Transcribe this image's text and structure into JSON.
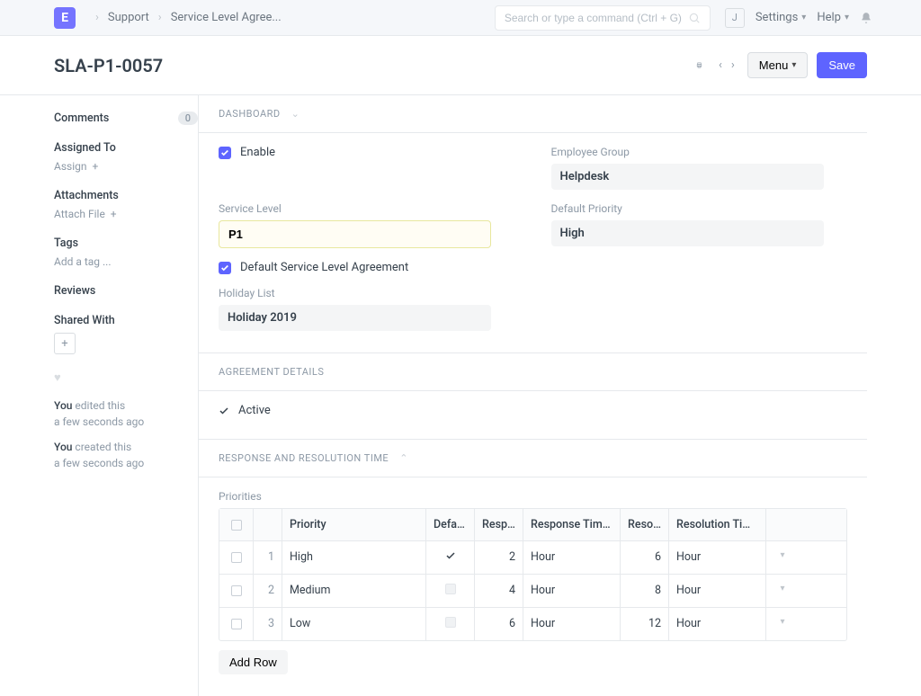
{
  "topbar": {
    "logo_letter": "E",
    "breadcrumb": [
      "Support",
      "Service Level Agree..."
    ],
    "search_placeholder": "Search or type a command (Ctrl + G)",
    "avatar_initial": "J",
    "settings_label": "Settings",
    "help_label": "Help"
  },
  "header": {
    "title": "SLA-P1-0057",
    "menu_label": "Menu",
    "save_label": "Save"
  },
  "sidebar": {
    "comments_label": "Comments",
    "comments_count": "0",
    "assigned_to_label": "Assigned To",
    "assign_action": "Assign",
    "attachments_label": "Attachments",
    "attach_action": "Attach File",
    "tags_label": "Tags",
    "add_tag_action": "Add a tag ...",
    "reviews_label": "Reviews",
    "shared_with_label": "Shared With",
    "activity": [
      {
        "who": "You",
        "what": "edited this",
        "when": "a few seconds ago"
      },
      {
        "who": "You",
        "what": "created this",
        "when": "a few seconds ago"
      }
    ]
  },
  "sections": {
    "dashboard_title": "DASHBOARD",
    "agreement_details_title": "AGREEMENT DETAILS",
    "rrt_title": "RESPONSE AND RESOLUTION TIME"
  },
  "form": {
    "enable_label": "Enable",
    "service_level_label": "Service Level",
    "service_level_value": "P1",
    "default_sla_label": "Default Service Level Agreement",
    "holiday_list_label": "Holiday List",
    "holiday_list_value": "Holiday 2019",
    "employee_group_label": "Employee Group",
    "employee_group_value": "Helpdesk",
    "default_priority_label": "Default Priority",
    "default_priority_value": "High",
    "active_label": "Active",
    "priorities_label": "Priorities",
    "table_headers": {
      "priority": "Priority",
      "default": "Defaul...",
      "response": "Respo...",
      "response_period": "Response Time Pe...",
      "resolution": "Resolu...",
      "resolution_period": "Resolution Time P..."
    },
    "rows": [
      {
        "idx": "1",
        "priority": "High",
        "default": true,
        "response": "2",
        "response_period": "Hour",
        "resolution": "6",
        "resolution_period": "Hour"
      },
      {
        "idx": "2",
        "priority": "Medium",
        "default": false,
        "response": "4",
        "response_period": "Hour",
        "resolution": "8",
        "resolution_period": "Hour"
      },
      {
        "idx": "3",
        "priority": "Low",
        "default": false,
        "response": "6",
        "response_period": "Hour",
        "resolution": "12",
        "resolution_period": "Hour"
      }
    ],
    "add_row_label": "Add Row"
  }
}
